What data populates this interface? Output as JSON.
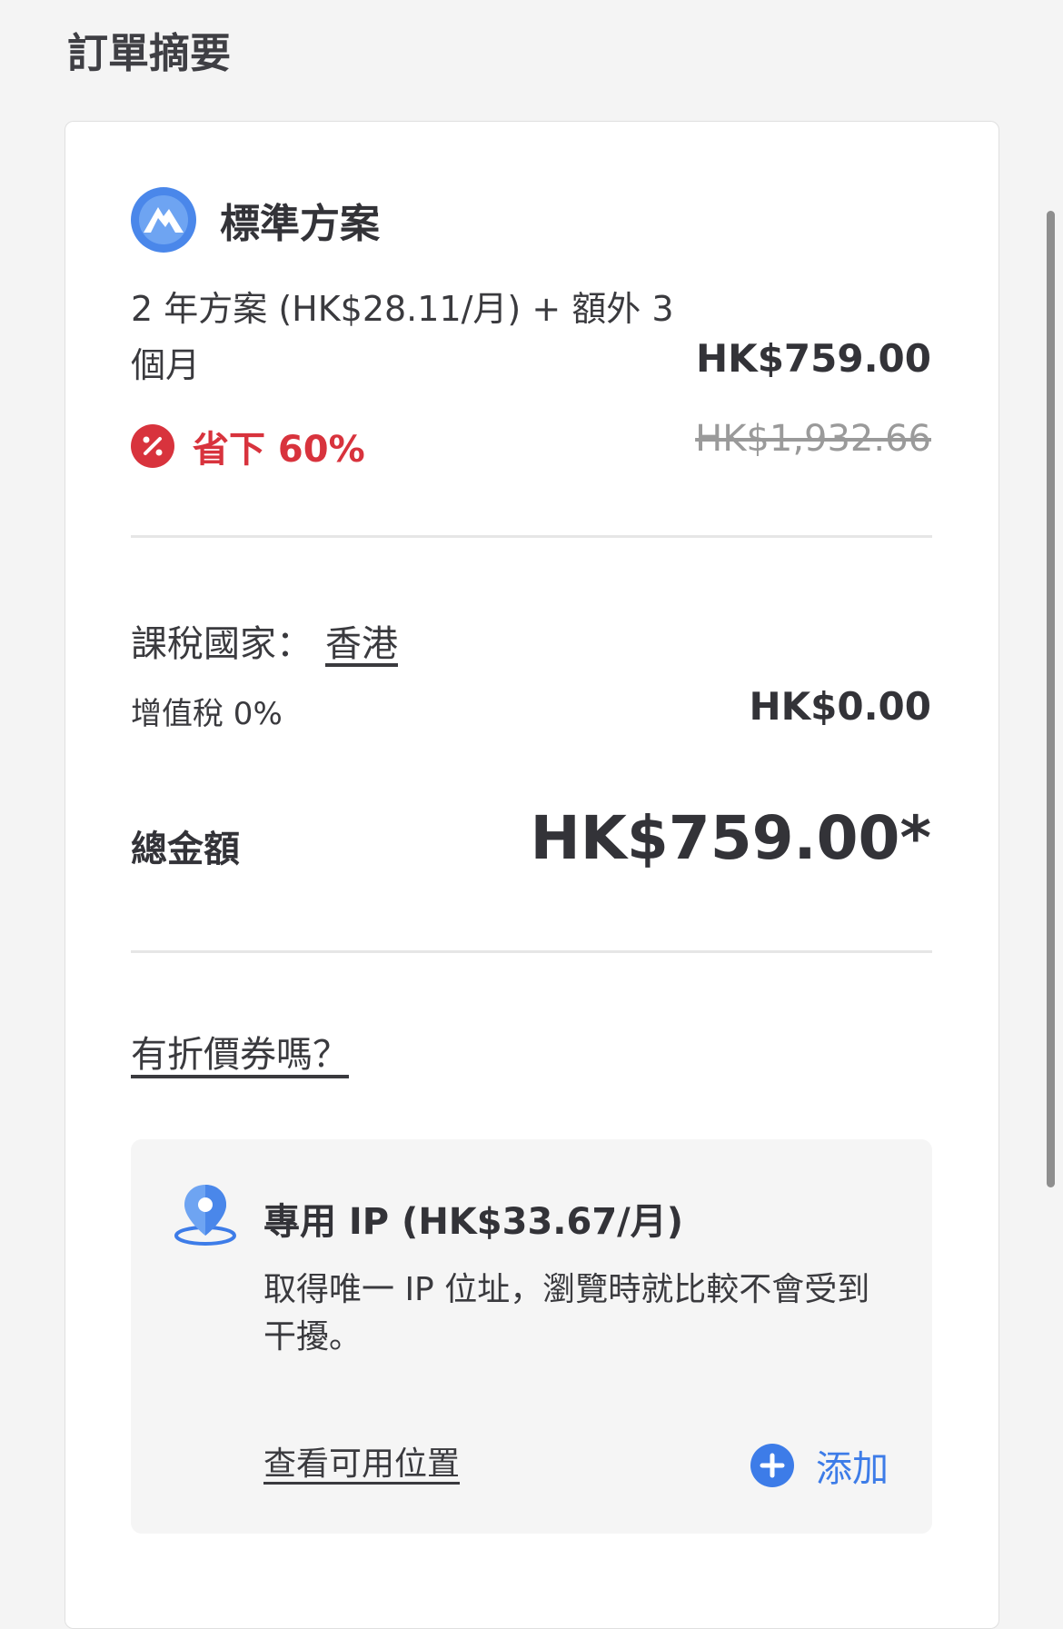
{
  "page": {
    "title": "訂單摘要"
  },
  "plan": {
    "name": "標準方案",
    "description": "2 年方案 (HK$28.11/月) + 額外 3 個月",
    "price": "HK$759.00",
    "savings": "省下 60%",
    "original_price": "HK$1,932.66"
  },
  "tax": {
    "country_label": "課稅國家：",
    "country_value": "香港",
    "vat_label": "增值稅 0%",
    "vat_amount": "HK$0.00"
  },
  "total": {
    "label": "總金額",
    "amount": "HK$759.00*"
  },
  "coupon": {
    "link": "有折價券嗎？"
  },
  "addon": {
    "title": "專用 IP (HK$33.67/月)",
    "description": "取得唯一 IP 位址，瀏覽時就比較不會受到干擾。",
    "locations_link": "查看可用位置",
    "add_label": "添加"
  },
  "icons": {
    "plan_logo": "mountain-logo-icon",
    "savings": "percent-badge-icon",
    "addon": "location-pin-icon",
    "add": "plus-circle-icon"
  },
  "colors": {
    "accent_blue": "#3d7ce8",
    "savings_red": "#d8333d",
    "text_dark": "#333338",
    "muted": "#9a9a9a"
  }
}
